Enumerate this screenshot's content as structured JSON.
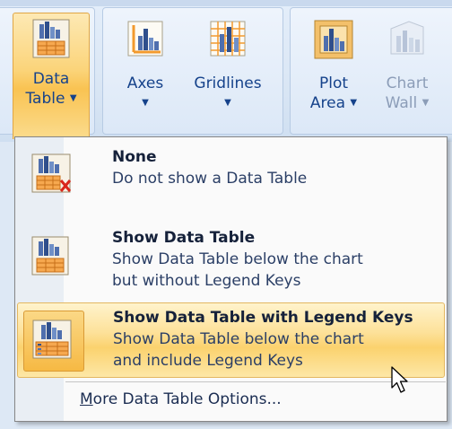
{
  "ribbon": {
    "data_table": {
      "line1": "Data",
      "line2": "Table",
      "arrow": "▼",
      "icon": "data-table-icon"
    },
    "axes": {
      "label": "Axes",
      "arrow": "▼",
      "icon": "axes-icon"
    },
    "gridlines": {
      "label": "Gridlines",
      "arrow": "▼",
      "icon": "gridlines-icon"
    },
    "plot_area": {
      "line1": "Plot",
      "line2": "Area",
      "arrow": "▼",
      "icon": "plot-area-icon"
    },
    "chart_wall": {
      "line1": "Chart",
      "line2": "Wall",
      "arrow": "▼",
      "icon": "chart-wall-icon"
    }
  },
  "menu": {
    "items": [
      {
        "title": "None",
        "desc": [
          "Do not show a Data Table"
        ],
        "icon": "no-data-table-icon"
      },
      {
        "title": "Show Data Table",
        "desc": [
          "Show Data Table below the chart",
          "but without Legend Keys"
        ],
        "icon": "show-data-table-icon"
      },
      {
        "title": "Show Data Table with Legend Keys",
        "desc": [
          "Show Data Table below the chart",
          "and include Legend Keys"
        ],
        "icon": "data-table-legend-keys-icon",
        "highlighted": true
      }
    ],
    "more_options": {
      "accel": "M",
      "rest": "ore Data Table Options..."
    }
  },
  "colors": {
    "accent_highlight": "#fbd26e",
    "ribbon_text": "#15428b",
    "menu_border": "#868686"
  }
}
